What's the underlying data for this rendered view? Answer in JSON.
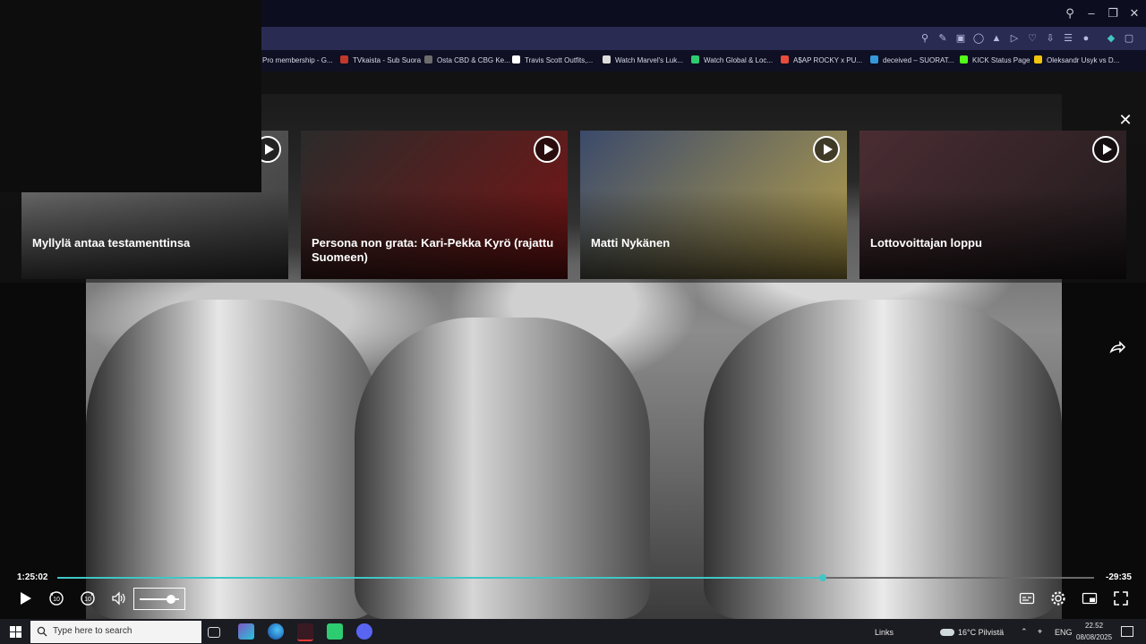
{
  "browser": {
    "bookmarks": [
      {
        "label": "Pro membership - G...",
        "color": "#5b7bd5"
      },
      {
        "label": "TVkaista - Sub Suora",
        "color": "#c0392b"
      },
      {
        "label": "Osta CBD & CBG Ke...",
        "color": "#6c6c6c"
      },
      {
        "label": "Travis Scott Outfits,...",
        "color": "#ffffff"
      },
      {
        "label": "Watch Marvel's Luk...",
        "color": "#dddddd"
      },
      {
        "label": "Watch Global & Loc...",
        "color": "#2ecc71"
      },
      {
        "label": "A$AP ROCKY x PU...",
        "color": "#e74c3c"
      },
      {
        "label": "deceived – SUORAT...",
        "color": "#3498db"
      },
      {
        "label": "KICK Status Page",
        "color": "#53fc18"
      },
      {
        "label": "Oleksandr Usyk vs D...",
        "color": "#f1c40f"
      }
    ]
  },
  "player": {
    "recommendations": [
      {
        "title": "Myllylä antaa testamenttinsa",
        "thumb_colors": [
          "#6f6f6f",
          "#3c3c3c"
        ]
      },
      {
        "title": "Persona non grata: Kari-Pekka Kyrö (rajattu Suomeen)",
        "thumb_colors": [
          "#2b2b2b",
          "#7a1414"
        ]
      },
      {
        "title": "Matti Nykänen",
        "thumb_colors": [
          "#3b4a6b",
          "#b8a14a"
        ]
      },
      {
        "title": "Lottovoittajan loppu",
        "thumb_colors": [
          "#4a2d33",
          "#1f1a1c"
        ]
      }
    ],
    "elapsed": "1:25:02",
    "remaining": "-29:35",
    "progress_fraction": 0.738,
    "volume_fraction": 0.8,
    "accent_color": "#43c5c5"
  },
  "taskbar": {
    "search_placeholder": "Type here to search",
    "links_label": "Links",
    "weather": "16°C  Pilvistä",
    "language": "ENG",
    "time": "22.52",
    "date": "08/08/2025"
  }
}
